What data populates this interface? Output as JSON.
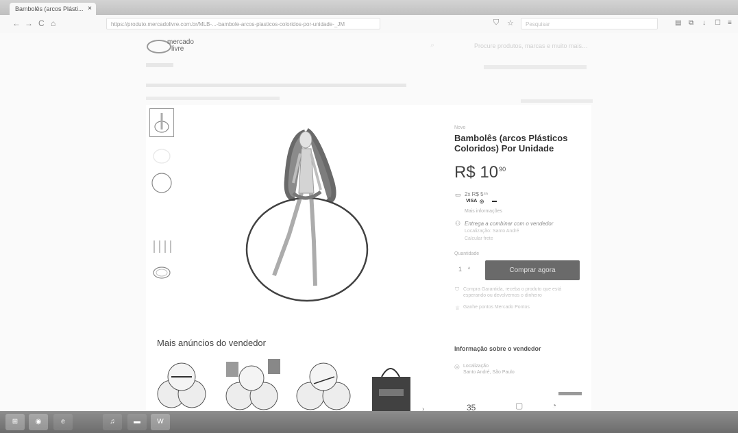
{
  "browser": {
    "tab_title": "Bambolês (arcos Plásti...",
    "tab_close": "×",
    "url": "https://produto.mercadolivre.com.br/MLB-...-bambole-arcos-plasticos-coloridos-por-unidade-_JM",
    "search_placeholder": "Pesquisar",
    "back_icon": "←",
    "forward_icon": "→",
    "reload_icon": "C",
    "home_icon": "⌂"
  },
  "site": {
    "logo_text_line1": "mercado",
    "logo_text_line2": "livre",
    "header_search_placeholder": "Procure produtos, marcas e muito mais…"
  },
  "product": {
    "condition": "Novo",
    "title": "Bambolês (arcos Plásticos Coloridos) Por Unidade",
    "price_currency": "R$",
    "price_integer": "10",
    "price_cents": "90",
    "installments": "2x R$ 5⁴⁵",
    "payment_brands": [
      "VISA",
      "◎",
      "▬"
    ],
    "payment_link": "Mais informações",
    "delivery": "Entrega a combinar com o vendedor",
    "delivery_sub": "Localização: Santo André",
    "delivery_calc": "Calcular frete",
    "quantity_label": "Quantidade",
    "quantity_value": "1",
    "buy_button": "Comprar agora",
    "protect_text": "Compra Garantida, receba o produto que está esperando ou devolvemos o dinheiro",
    "points_text": "Ganhe pontos Mercado Pontos"
  },
  "sections": {
    "more_ads_title": "Mais anúncios do vendedor",
    "seller_info_title": "Informação sobre o vendedor",
    "seller_location": "Localização\nSanto André, São Paulo",
    "sales_count": "35"
  },
  "taskbar": {
    "word_icon": "W"
  }
}
